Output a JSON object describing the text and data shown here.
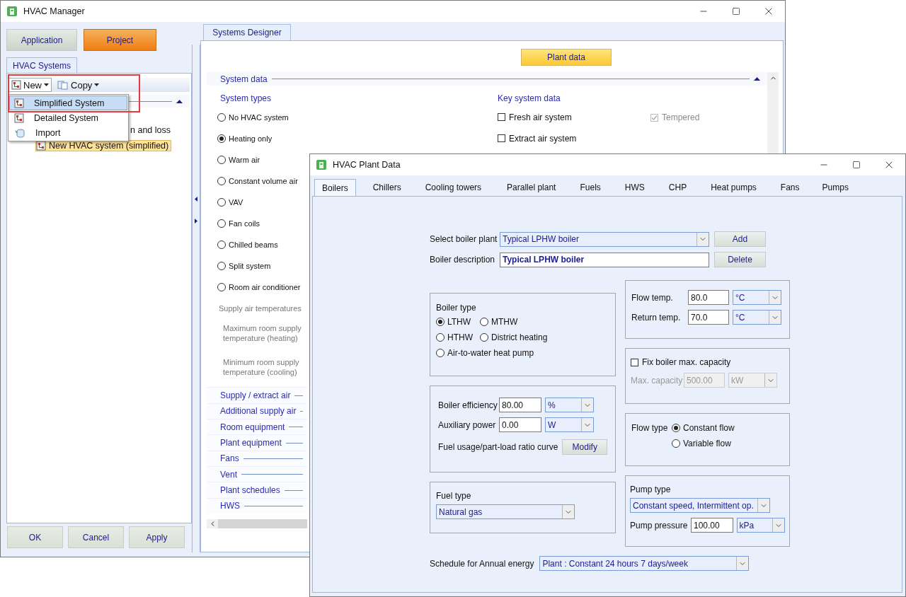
{
  "manager": {
    "title": "HVAC Manager",
    "mode_buttons": [
      {
        "label": "Application",
        "selected": false
      },
      {
        "label": "Project",
        "selected": true
      }
    ],
    "left_tab": "HVAC Systems",
    "toolbar": [
      {
        "label": "New",
        "kind": "new",
        "pressed": true
      },
      {
        "label": "Copy",
        "kind": "copy",
        "pressed": false
      }
    ],
    "menu": [
      {
        "label": "Simplified System",
        "kind": "system",
        "selected": true
      },
      {
        "label": "Detailed System",
        "kind": "system",
        "selected": false
      },
      {
        "label": "Import",
        "kind": "import",
        "selected": false
      }
    ],
    "tree": [
      {
        "label": "n and loss",
        "selected": false
      },
      {
        "label": "New HVAC system (simplified)",
        "selected": true
      }
    ],
    "buttons": [
      "OK",
      "Cancel",
      "Apply"
    ],
    "designer": {
      "tab": "Systems Designer",
      "plant_button": "Plant data",
      "section": "System data",
      "system_types_heading": "System types",
      "system_types": [
        {
          "label": "No HVAC system",
          "selected": false
        },
        {
          "label": "Heating only",
          "selected": true
        },
        {
          "label": "Warm air",
          "selected": false
        },
        {
          "label": "Constant volume air",
          "selected": false
        },
        {
          "label": "VAV",
          "selected": false
        },
        {
          "label": "Fan coils",
          "selected": false
        },
        {
          "label": "Chilled beams",
          "selected": false
        },
        {
          "label": "Split system",
          "selected": false
        },
        {
          "label": "Room air conditioner",
          "selected": false
        }
      ],
      "key_heading": "Key system data",
      "key_options": [
        {
          "label": "Fresh air system",
          "checked": false
        },
        {
          "label": "Extract air system",
          "checked": false
        }
      ],
      "tempered": {
        "label": "Tempered",
        "checked": true,
        "disabled": true
      },
      "supply_heading": "Supply air temperatures",
      "supply_rows": [
        {
          "lines": [
            "Maximum room supply",
            "temperature (heating)"
          ]
        },
        {
          "lines": [
            "Minimum room supply",
            "temperature (cooling)"
          ]
        }
      ],
      "sections": [
        "Supply / extract air",
        "Additional supply air",
        "Room equipment",
        "Plant equipment",
        "Fans",
        "Vent",
        "Plant schedules",
        "HWS"
      ]
    }
  },
  "plant": {
    "title": "HVAC Plant Data",
    "tabs": [
      {
        "label": "Boilers",
        "selected": true
      },
      {
        "label": "Chillers",
        "selected": false
      },
      {
        "label": "Cooling towers",
        "selected": false
      },
      {
        "label": "Parallel plant",
        "selected": false
      },
      {
        "label": "Fuels",
        "selected": false
      },
      {
        "label": "HWS",
        "selected": false
      },
      {
        "label": "CHP",
        "selected": false
      },
      {
        "label": "Heat pumps",
        "selected": false
      },
      {
        "label": "Fans",
        "selected": false
      },
      {
        "label": "Pumps",
        "selected": false
      }
    ],
    "select_plant": {
      "label": "Select boiler plant",
      "value": "Typical LPHW boiler"
    },
    "add_button": "Add",
    "description": {
      "label": "Boiler description",
      "value": "Typical LPHW boiler"
    },
    "delete_button": "Delete",
    "boiler_type": {
      "heading": "Boiler type",
      "options": [
        {
          "label": "LTHW",
          "selected": true
        },
        {
          "label": "MTHW",
          "selected": false
        },
        {
          "label": "HTHW",
          "selected": false
        },
        {
          "label": "District heating",
          "selected": false
        },
        {
          "label": "Air-to-water heat pump",
          "selected": false
        }
      ]
    },
    "efficiency": {
      "label": "Boiler efficiency",
      "value": "80.00",
      "unit": "%"
    },
    "auxiliary": {
      "label": "Auxiliary power",
      "value": "0.00",
      "unit": "W"
    },
    "curve": {
      "label": "Fuel usage/part-load ratio curve",
      "button": "Modify"
    },
    "fuel_type": {
      "heading": "Fuel type",
      "value": "Natural gas"
    },
    "flow_temp": {
      "label": "Flow temp.",
      "value": "80.0",
      "unit": "°C"
    },
    "return_temp": {
      "label": "Return temp.",
      "value": "70.0",
      "unit": "°C"
    },
    "fix_capacity": {
      "label": "Fix boiler max. capacity",
      "checked": false
    },
    "max_capacity": {
      "label": "Max. capacity",
      "value": "500.00",
      "unit": "kW",
      "disabled": true
    },
    "flow_type": {
      "label": "Flow type",
      "options": [
        {
          "label": "Constant flow",
          "selected": true
        },
        {
          "label": "Variable flow",
          "selected": false
        }
      ]
    },
    "pump_type": {
      "heading": "Pump type",
      "value": "Constant speed, Intermittent op."
    },
    "pump_pressure": {
      "label": "Pump pressure",
      "value": "100.00",
      "unit": "kPa"
    },
    "schedule": {
      "label": "Schedule for Annual energy",
      "value": "Plant : Constant 24 hours 7 days/week"
    }
  }
}
